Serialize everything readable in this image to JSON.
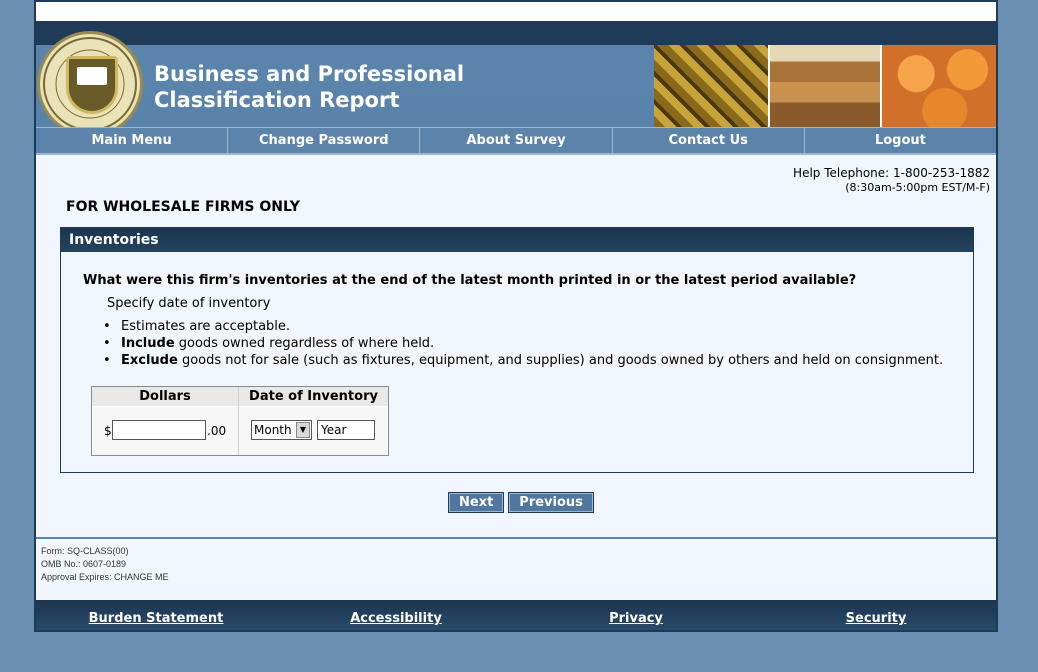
{
  "header": {
    "title_line1": "Business and Professional",
    "title_line2": "Classification Report",
    "seal_text": "U.S. DEPARTMENT OF COMMERCE · BUREAU OF THE CENSUS"
  },
  "nav": [
    {
      "label": "Main Menu"
    },
    {
      "label": "Change Password"
    },
    {
      "label": "About Survey"
    },
    {
      "label": "Contact Us"
    },
    {
      "label": "Logout"
    }
  ],
  "help": {
    "telephone": "Help Telephone: 1-800-253-1882",
    "hours": "(8:30am-5:00pm EST/M-F)"
  },
  "page_heading": "FOR WHOLESALE FIRMS ONLY",
  "panel": {
    "title": "Inventories",
    "question": "What were this firm's inventories at the end of the latest month printed in or the latest period available?",
    "specify": "Specify date of inventory",
    "bullets": [
      {
        "bold": "",
        "text": "Estimates are acceptable."
      },
      {
        "bold": "Include",
        "text": " goods owned regardless of where held."
      },
      {
        "bold": "Exclude",
        "text": " goods not for sale (such as fixtures, equipment, and supplies) and goods owned by others and held on consignment."
      }
    ],
    "table": {
      "dollars_header": "Dollars",
      "date_header": "Date of Inventory",
      "dollar_sign": "$",
      "cents": ".00",
      "dollars_value": "",
      "month_selected": "Month",
      "year_value": "Year"
    }
  },
  "buttons": {
    "next": "Next",
    "previous": "Previous"
  },
  "form_info": {
    "form": "Form: SQ-CLASS(00)",
    "omb": "OMB No.: 0607-0189",
    "approval": "Approval Expires: CHANGE ME"
  },
  "footer_links": [
    {
      "label": "Burden Statement"
    },
    {
      "label": "Accessibility"
    },
    {
      "label": "Privacy"
    },
    {
      "label": "Security"
    }
  ]
}
